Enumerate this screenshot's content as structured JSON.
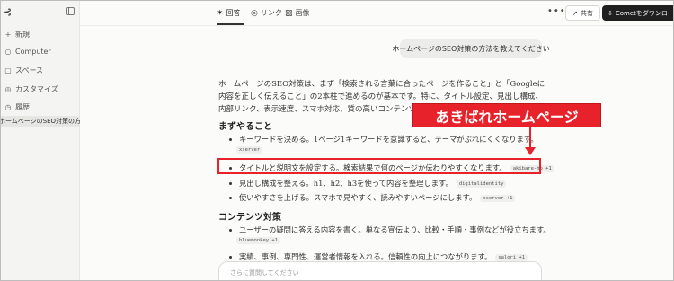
{
  "sidebar": {
    "logo": "⊰",
    "items": [
      {
        "icon": "+",
        "label": "新規"
      },
      {
        "icon": "○",
        "label": "Computer"
      },
      {
        "icon": "▢",
        "label": "スペース"
      },
      {
        "icon": "◎",
        "label": "カスタマイズ"
      },
      {
        "icon": "◷",
        "label": "履歴"
      }
    ],
    "active_thread": "ホームページのSEO対策の方法を..."
  },
  "topbar": {
    "tabs": [
      {
        "icon": "✶",
        "label": "回答"
      },
      {
        "icon": "◎",
        "label": "リンク"
      },
      {
        "icon": "▨",
        "label": "画像"
      }
    ],
    "more": "•••",
    "share_label": "共有",
    "download_label": "Cometをダウンロード"
  },
  "question": "ホームページのSEO対策の方法を教えてください",
  "answer": {
    "intro": "ホームページのSEO対策は、まず「検索される言葉に合ったページを作ること」と「Googleに内容を正しく伝えること」の2本柱で進めるのが基本です。特に、タイトル設定、見出し構成、内部リンク、表示速度、スマホ対応、質の高いコンテンツが重要です。",
    "section1_title": "まずやること",
    "section1_items": [
      {
        "text": "キーワードを決める。1ページ1キーワードを意識すると、テーマがぶれにくくなります。",
        "chip": "xserver"
      },
      {
        "text": "タイトルと説明文を設定する。検索結果で何のページか伝わりやすくなります。",
        "chip": "akibare-hp +1"
      },
      {
        "text": "見出し構成を整える。h1、h2、h3を使って内容を整理します。",
        "chip": "digitalidentity"
      },
      {
        "text": "使いやすさを上げる。スマホで見やすく、読みやすいページにします。",
        "chip": "xserver +1"
      }
    ],
    "section2_title": "コンテンツ対策",
    "section2_items": [
      {
        "text": "ユーザーの疑問に答える内容を書く。単なる宣伝より、比較・手順・事例などが役立ちます。",
        "chip": "bluemonkey +1"
      },
      {
        "text": "実績、事例、専門性、運営者情報を入れる。信頼性の向上につながります。",
        "chip": "salori +1"
      }
    ]
  },
  "callout": "あきばれホームページ",
  "ask_placeholder": "さらに質問してください",
  "colors": {
    "accent_red": "#e8222b",
    "dark_button": "#1f1f1f"
  }
}
